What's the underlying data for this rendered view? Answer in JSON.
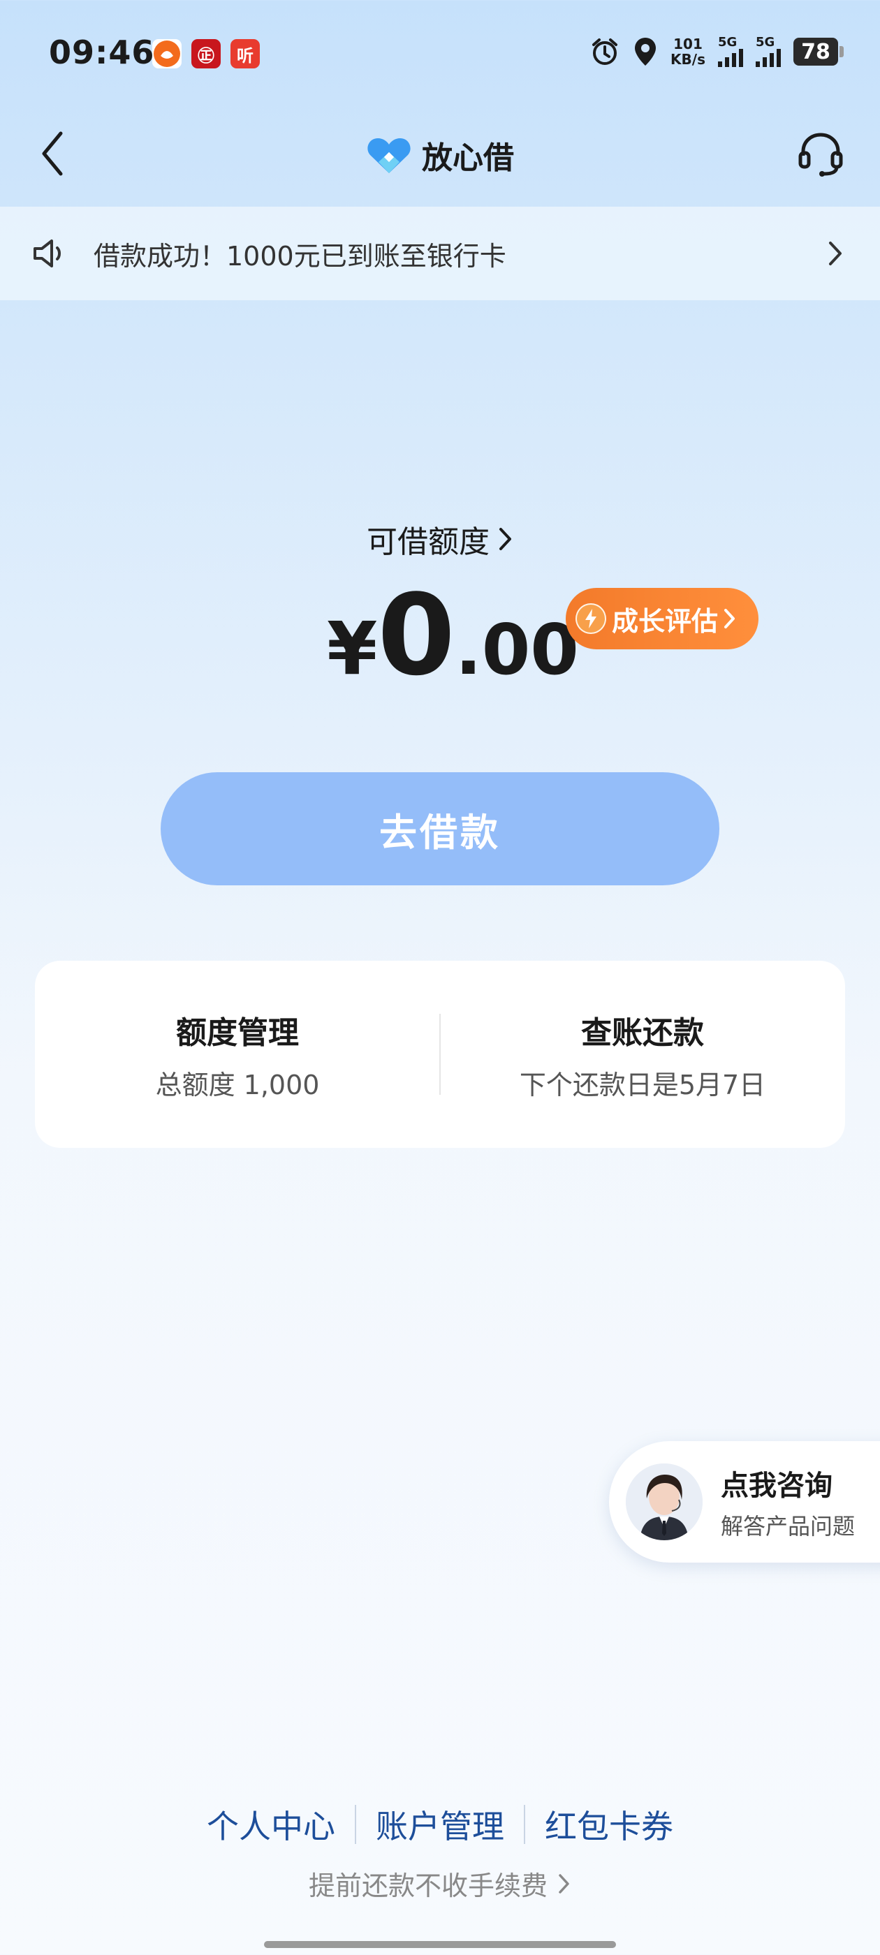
{
  "status_bar": {
    "time": "09:46",
    "app_badges": [
      {
        "icon": "weibo-app-icon",
        "color": "#f36b1c",
        "text": ""
      },
      {
        "icon": "bank-app-icon",
        "color": "#c8161d",
        "text": "㊣"
      },
      {
        "icon": "listen-app-icon",
        "color": "#e83b2e",
        "text": "听"
      }
    ],
    "net_speed_value": "101",
    "net_speed_unit": "KB/s",
    "signal1_label": "5G",
    "signal2_label": "5G",
    "battery": "78"
  },
  "nav": {
    "title": "放心借",
    "logo_color": "#3a9bf2"
  },
  "notice": {
    "text": "借款成功！1000元已到账至银行卡"
  },
  "credit": {
    "label": "可借额度",
    "currency": "¥",
    "amount_int": "0",
    "amount_dec": ".00",
    "growth_label": "成长评估"
  },
  "borrow_button": "去借款",
  "card": {
    "left_title": "额度管理",
    "left_sub": "总额度 1,000",
    "right_title": "查账还款",
    "right_sub": "下个还款日是5月7日"
  },
  "consult": {
    "title": "点我咨询",
    "subtitle": "解答产品问题"
  },
  "footer": {
    "links": [
      "个人中心",
      "账户管理",
      "红包卡券"
    ],
    "note": "提前还款不收手续费"
  },
  "colors": {
    "accent": "#1d4e9a",
    "button": "#94bdf9",
    "badge": "#f37a2a"
  }
}
